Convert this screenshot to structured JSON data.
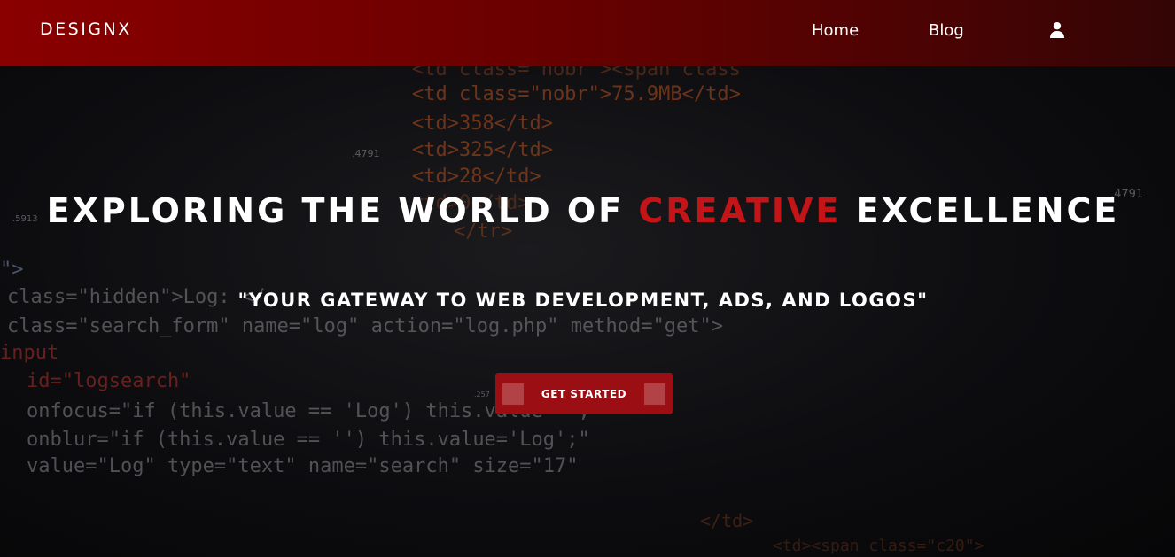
{
  "nav": {
    "brand": "DESIGNX",
    "links": [
      "Home",
      "Blog"
    ],
    "user_icon": "user-icon"
  },
  "hero": {
    "title_part1": "EXPLORING THE WORLD OF ",
    "title_accent": "CREATIVE",
    "title_part2": " EXCELLENCE",
    "subtitle": "\"YOUR GATEWAY TO WEB DEVELOPMENT, ADS, AND LOGOS\"",
    "cta_label": "GET STARTED"
  },
  "background_code": [
    "<td class=\"nobr\"><span class",
    "<td class=\"nobr\">75.9MB</td>",
    "<td>358</td>",
    "<td>325</td>",
    "<td>28</td>",
    "<td>0</td>",
    "</tr>",
    "\">",
    "class=\"hidden\">Log: </",
    "class=\"search_form\" name=\"log\" action=\"log.php\" method=\"get\">",
    "input",
    "id=\"logsearch\"",
    "onfocus=\"if (this.value == 'Log') this.value='';\"",
    "onblur=\"if (this.value == '') this.value='Log';\"",
    "value=\"Log\" type=\"text\" name=\"search\" size=\"17\"",
    "</td>",
    "<td><span class=\"c20\">"
  ],
  "background_numbers": [
    ".4791",
    ".4791",
    ".5913",
    ".257"
  ],
  "colors": {
    "navbar_start": "#8a0000",
    "navbar_end": "#330505",
    "accent": "#c51417",
    "button": "#9b0f14"
  }
}
